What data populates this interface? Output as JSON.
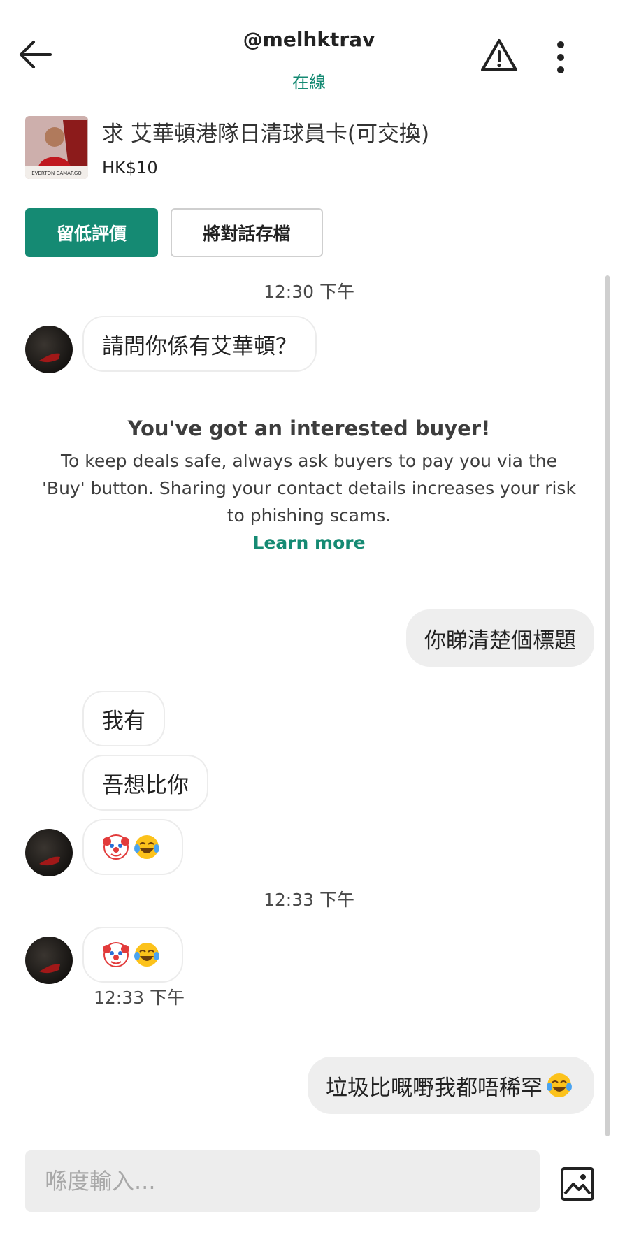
{
  "header": {
    "username": "@melhktrav",
    "status": "在線"
  },
  "listing": {
    "title": "求 艾華頓港隊日清球員卡(可交換)",
    "price": "HK$10",
    "thumb_text": "EVERTON CAMARGO"
  },
  "actions": {
    "review_label": "留低評價",
    "archive_label": "將對話存檔"
  },
  "messages": {
    "time1": "12:30 下午",
    "msg1": "請問你係有艾華頓？",
    "reply1": "你睇清楚個標題",
    "msg2": "我有",
    "msg3": "吾想比你",
    "time2": "12:33 下午",
    "last_time": "12:33 下午",
    "reply2": "垃圾比嘅嘢我都唔稀罕"
  },
  "notice": {
    "title": "You've got an interested buyer!",
    "body": "To keep deals safe, always ask buyers to pay you via the 'Buy' button. Sharing your contact details increases your risk to phishing scams.",
    "link": "Learn more"
  },
  "composer": {
    "placeholder": "喺度輸入..."
  },
  "icons": {
    "back": "back-arrow-icon",
    "warning": "warning-icon",
    "more": "more-vertical-icon",
    "image": "image-upload-icon",
    "clown": "clown-face-emoji",
    "laugh": "tears-of-joy-emoji"
  },
  "colors": {
    "accent": "#158a73",
    "bubble_out": "#eeeeee",
    "input_bg": "#ededed"
  }
}
